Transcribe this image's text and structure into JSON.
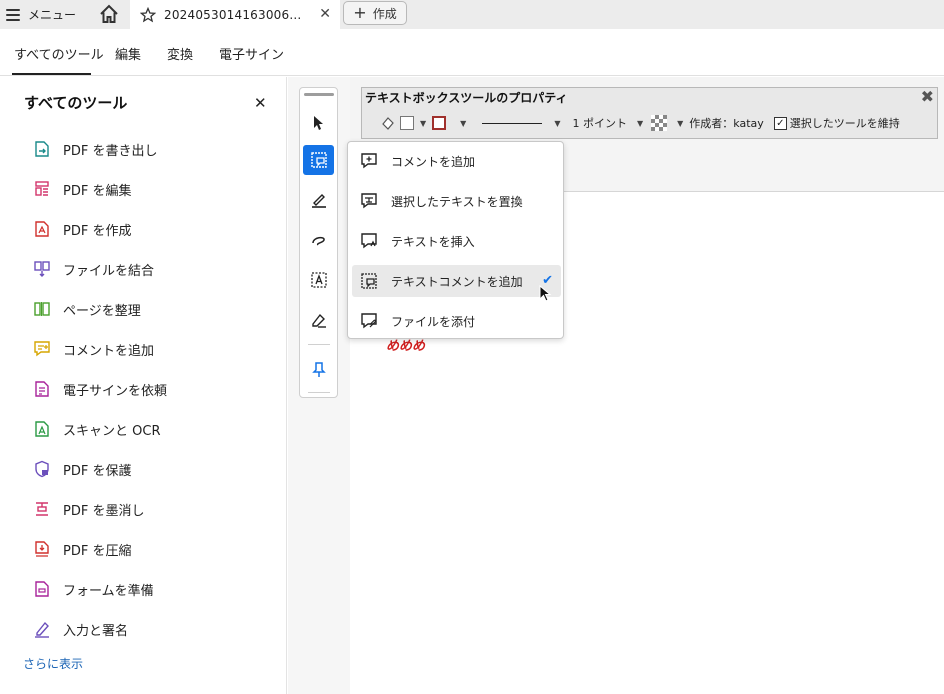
{
  "titlebar": {
    "menu_label": "メニュー",
    "tab_name": "2024053014163006...",
    "create_label": "作成"
  },
  "topnav": {
    "items": [
      "すべてのツール",
      "編集",
      "変換",
      "電子サイン"
    ],
    "active": "すべてのツール"
  },
  "left_panel": {
    "title": "すべてのツール",
    "tools": [
      {
        "label": "PDF を書き出し",
        "icon": "export-pdf-icon",
        "color": "#1a8a8a"
      },
      {
        "label": "PDF を編集",
        "icon": "edit-pdf-icon",
        "color": "#d2356b"
      },
      {
        "label": "PDF を作成",
        "icon": "create-pdf-icon",
        "color": "#d0312d"
      },
      {
        "label": "ファイルを結合",
        "icon": "combine-files-icon",
        "color": "#6b4fbb"
      },
      {
        "label": "ページを整理",
        "icon": "organize-pages-icon",
        "color": "#4aa02c"
      },
      {
        "label": "コメントを追加",
        "icon": "add-comment-icon",
        "color": "#d6a500"
      },
      {
        "label": "電子サインを依頼",
        "icon": "request-esign-icon",
        "color": "#a8239a"
      },
      {
        "label": "スキャンと OCR",
        "icon": "scan-ocr-icon",
        "color": "#2b9a45"
      },
      {
        "label": "PDF を保護",
        "icon": "protect-pdf-icon",
        "color": "#6b4fbb"
      },
      {
        "label": "PDF を墨消し",
        "icon": "redact-pdf-icon",
        "color": "#d2356b"
      },
      {
        "label": "PDF を圧縮",
        "icon": "compress-pdf-icon",
        "color": "#d0312d"
      },
      {
        "label": "フォームを準備",
        "icon": "prepare-form-icon",
        "color": "#a8239a"
      },
      {
        "label": "入力と署名",
        "icon": "fill-sign-icon",
        "color": "#6b4fbb"
      }
    ],
    "more_label": "さらに表示"
  },
  "properties": {
    "title": "テキストボックスツールのプロパティ",
    "line_width": "1 ポイント",
    "author": "作成者：katay",
    "keep_tool_label": "選択したツールを維持",
    "keep_tool_checked": true
  },
  "dropdown": {
    "items": [
      {
        "label": "コメントを追加",
        "icon": "add-comment-icon",
        "checked": false
      },
      {
        "label": "選択したテキストを置換",
        "icon": "replace-text-icon",
        "checked": false
      },
      {
        "label": "テキストを挿入",
        "icon": "insert-text-icon",
        "checked": false
      },
      {
        "label": "テキストコメントを追加",
        "icon": "text-comment-icon",
        "checked": true
      },
      {
        "label": "ファイルを添付",
        "icon": "attach-file-icon",
        "checked": false
      }
    ]
  },
  "document": {
    "text": "めめめ"
  },
  "colors": {
    "accent": "#1473e6",
    "doc_text": "#d11f1f",
    "link": "#1b64b5"
  }
}
